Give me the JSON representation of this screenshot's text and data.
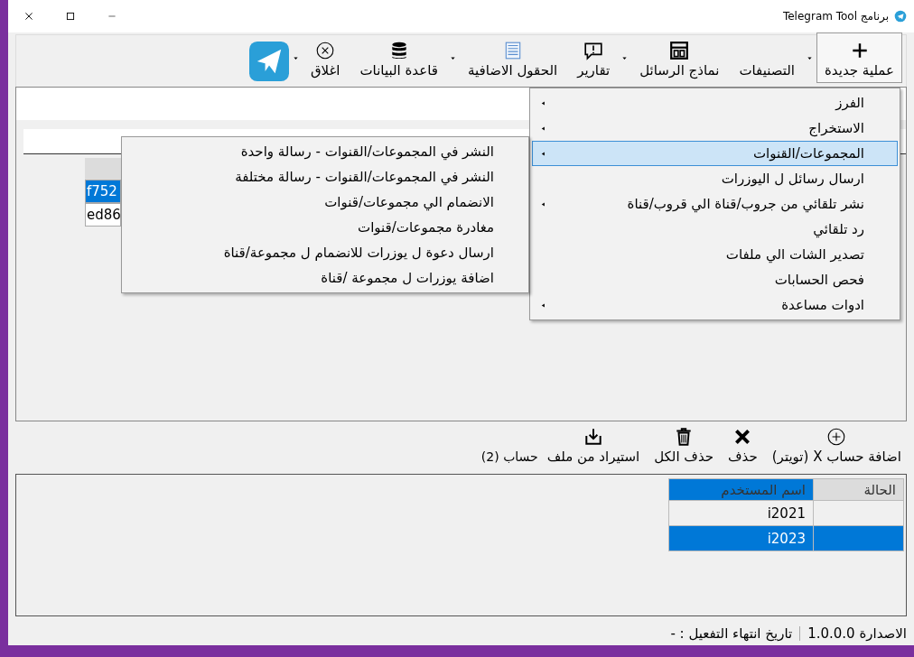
{
  "window": {
    "title": "برنامج Telegram Tool"
  },
  "toolbar": [
    {
      "label": "عملية جديدة",
      "dropdown": true,
      "selected": true
    },
    {
      "label": "التصنيفات",
      "dropdown": false,
      "selected": false
    },
    {
      "label": "نماذج الرسائل",
      "dropdown": true,
      "selected": false
    },
    {
      "label": "تقارير",
      "dropdown": false,
      "selected": false
    },
    {
      "label": "الحقول الاضافية",
      "dropdown": true,
      "selected": false
    },
    {
      "label": "قاعدة البيانات",
      "dropdown": false,
      "selected": false
    },
    {
      "label": "اغلاق",
      "dropdown": true,
      "selected": false
    }
  ],
  "menu": [
    {
      "label": "الفرز",
      "submenu": true,
      "selected": false
    },
    {
      "label": "الاستخراج",
      "submenu": true,
      "selected": false
    },
    {
      "label": "المجموعات/القنوات",
      "submenu": true,
      "selected": true
    },
    {
      "label": "ارسال رسائل ل اليوزرات",
      "submenu": false,
      "selected": false
    },
    {
      "label": "نشر تلقائي من جروب/قناة الي قروب/قناة",
      "submenu": true,
      "selected": false
    },
    {
      "label": "رد تلقائي",
      "submenu": false,
      "selected": false
    },
    {
      "label": "تصدير الشات الي ملفات",
      "submenu": false,
      "selected": false
    },
    {
      "label": "فحص الحسابات",
      "submenu": false,
      "selected": false
    },
    {
      "label": "ادوات مساعدة",
      "submenu": true,
      "selected": false
    }
  ],
  "submenu": [
    "النشر في المجموعات/القنوات - رسالة واحدة",
    "النشر في المجموعات/القنوات -  رسالة مختلفة",
    "الانضمام الي مجموعات/قنوات",
    "مغادرة مجموعات/قنوات",
    "ارسال دعوة ل يوزرات للانضمام ل مجموعة/قناة",
    "اضافة يوزرات ل مجموعة /قناة"
  ],
  "upper_table": {
    "rows": [
      {
        "cell": "f752",
        "selected": true
      },
      {
        "cell": "ed86",
        "selected": false
      }
    ]
  },
  "accounts_toolbar": {
    "buttons": [
      "اضافة حساب X (تويتر)",
      "حذف",
      "حذف الكل",
      "استيراد من ملف"
    ],
    "count": "حساب (2)"
  },
  "accounts_table": {
    "columns": [
      {
        "label": "الحالة",
        "selected": false
      },
      {
        "label": "اسم المستخدم",
        "selected": true
      }
    ],
    "rows": [
      {
        "username": "i2021",
        "selected": false
      },
      {
        "username": "i2023",
        "selected": true
      }
    ]
  },
  "status_bar": {
    "version": "الاصدارة 1.0.0.0",
    "expiry": "تاريخ انتهاء التفعيل : -"
  }
}
